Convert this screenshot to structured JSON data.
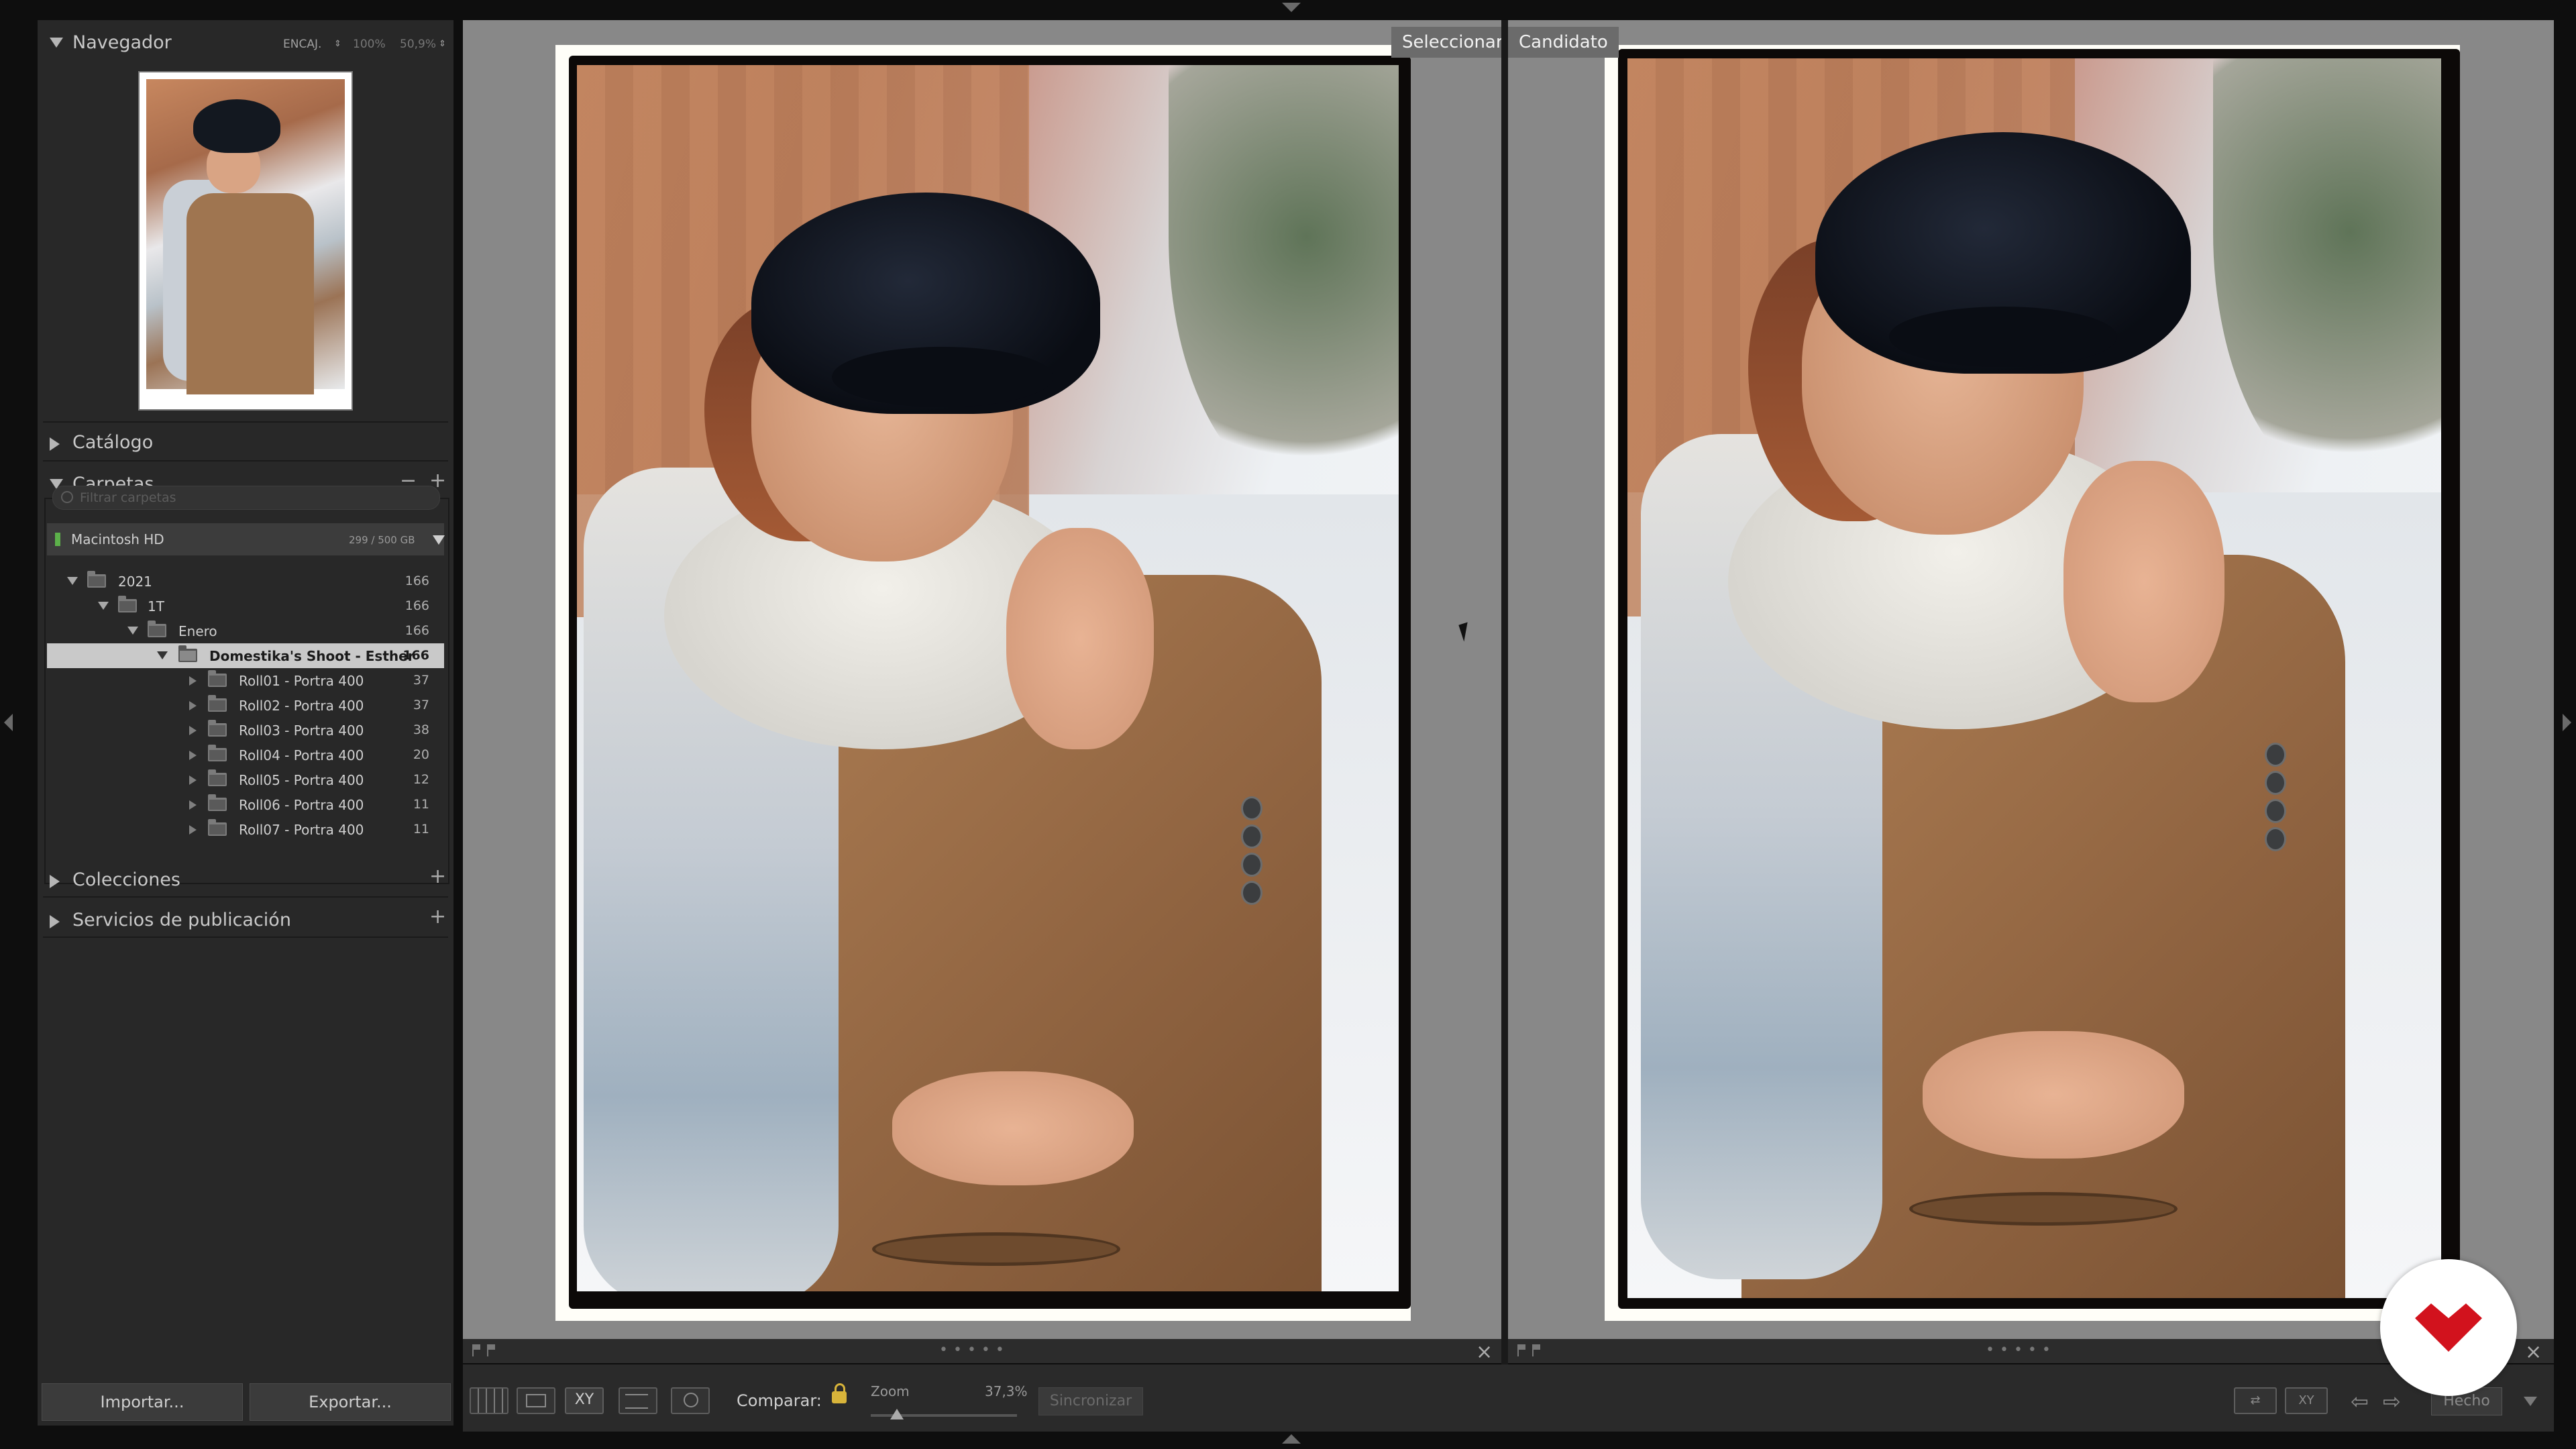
{
  "navigator": {
    "title": "Navegador",
    "zoom_options": [
      "ENCAJ.",
      "100%",
      "50,9%"
    ]
  },
  "catalog": {
    "title": "Catálogo"
  },
  "folders": {
    "title": "Carpetas",
    "filter_placeholder": "Filtrar carpetas",
    "volume": {
      "name": "Macintosh HD",
      "space": "299 / 500 GB"
    },
    "tree": [
      {
        "label": "2021",
        "count": "166"
      },
      {
        "label": "1T",
        "count": "166"
      },
      {
        "label": "Enero",
        "count": "166"
      },
      {
        "label": "Domestika's Shoot - Esther",
        "count": "166",
        "selected": true
      },
      {
        "label": "Roll01 - Portra 400",
        "count": "37"
      },
      {
        "label": "Roll02 - Portra 400",
        "count": "37"
      },
      {
        "label": "Roll03 - Portra 400",
        "count": "38"
      },
      {
        "label": "Roll04 - Portra 400",
        "count": "20"
      },
      {
        "label": "Roll05 - Portra 400",
        "count": "12"
      },
      {
        "label": "Roll06 - Portra 400",
        "count": "11"
      },
      {
        "label": "Roll07 - Portra 400",
        "count": "11"
      }
    ]
  },
  "collections": {
    "title": "Colecciones"
  },
  "publish": {
    "title": "Servicios de publicación"
  },
  "buttons": {
    "import": "Importar...",
    "export": "Exportar..."
  },
  "compare": {
    "select_label": "Seleccionar",
    "candidate_label": "Candidato"
  },
  "toolbar": {
    "compare_label": "Comparar:",
    "zoom_label": "Zoom",
    "zoom_value": "37,3%",
    "sync_label": "Sincronizar",
    "compare_view_icon": "XY",
    "done_label": "Hecho"
  },
  "colors": {
    "accent_selected": "#c9c9c9",
    "lock": "#d8b43a",
    "logo_red": "#d2121d"
  }
}
